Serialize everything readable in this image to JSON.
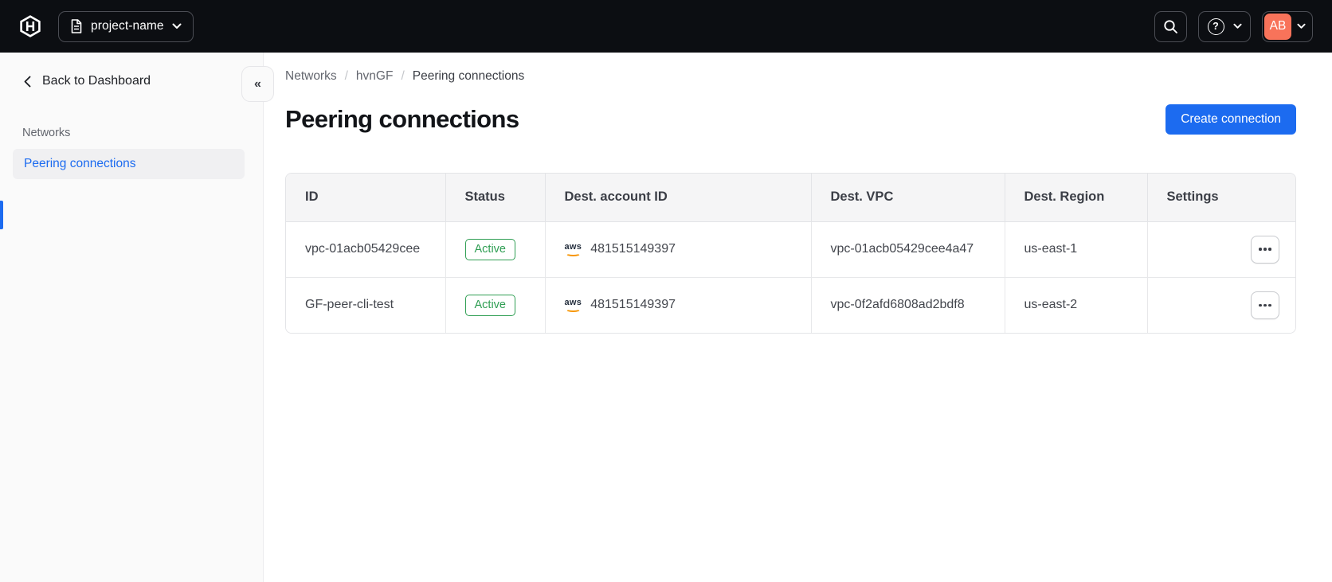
{
  "topbar": {
    "project_selector": {
      "label": "project-name"
    },
    "avatar_initials": "AB",
    "help_icon_glyph": "?"
  },
  "sidebar": {
    "back_label": "Back to Dashboard",
    "section_label": "Networks",
    "items": [
      {
        "label": "Peering connections",
        "active": true
      }
    ],
    "collapse_glyph": "«"
  },
  "breadcrumb": {
    "separator": "/",
    "items": [
      "Networks",
      "hvnGF",
      "Peering connections"
    ]
  },
  "page": {
    "title": "Peering connections",
    "create_button_label": "Create connection"
  },
  "table": {
    "columns": [
      "ID",
      "Status",
      "Dest. account ID",
      "Dest. VPC",
      "Dest. Region",
      "Settings"
    ],
    "rows": [
      {
        "id": "vpc-01acb05429cee",
        "status": "Active",
        "provider": "aws",
        "dest_account_id": "481515149397",
        "dest_vpc": "vpc-01acb05429cee4a47",
        "dest_region": "us-east-1"
      },
      {
        "id": "GF-peer-cli-test",
        "status": "Active",
        "provider": "aws",
        "dest_account_id": "481515149397",
        "dest_vpc": "vpc-0f2afd6808ad2bdf8",
        "dest_region": "us-east-2"
      }
    ]
  },
  "colors": {
    "accent_blue": "#1c6bf0",
    "status_green": "#2f9e53",
    "avatar_coral": "#f8735a",
    "topbar_bg": "#0c0e12"
  }
}
